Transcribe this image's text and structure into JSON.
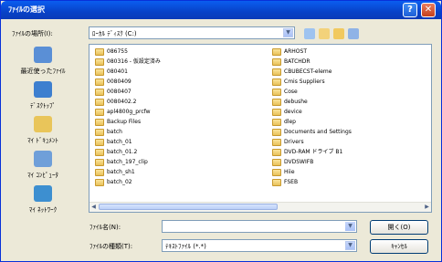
{
  "window": {
    "title": "ﾌｧｲﾙの選択",
    "help_glyph": "?",
    "close_glyph": "✕"
  },
  "lookin": {
    "label": "ﾌｧｲﾙの場所(I):",
    "value": "ﾛｰｶﾙ ﾃﾞｨｽｸ (C:)"
  },
  "places": [
    {
      "label": "最近使ったﾌｧｲﾙ",
      "icon": "recent-icon",
      "color": "#5a8fd6"
    },
    {
      "label": "ﾃﾞｽｸﾄｯﾌﾟ",
      "icon": "desktop-icon",
      "color": "#3d7fcf"
    },
    {
      "label": "ﾏｲ ﾄﾞｷｭﾒﾝﾄ",
      "icon": "my-documents-icon",
      "color": "#e9c55a"
    },
    {
      "label": "ﾏｲ ｺﾝﾋﾟｭｰﾀ",
      "icon": "my-computer-icon",
      "color": "#6f9fd9"
    },
    {
      "label": "ﾏｲ ﾈｯﾄﾜｰｸ",
      "icon": "my-network-icon",
      "color": "#3d8fd0"
    }
  ],
  "files_left": [
    "086755",
    "080316 - 仮設定済み",
    "080401",
    "0080409",
    "0080407",
    "0080402.2",
    "apl4800g_prcfw",
    "Backup Files",
    "batch",
    "batch_01",
    "batch_01.2",
    "batch_197_clip",
    "batch_sh1",
    "batch_02"
  ],
  "files_right": [
    "ARHOST",
    "BATCHDR",
    "CBUBECST-eleme",
    "Cmis Suppliers",
    "Cose",
    "debushe",
    "device",
    "dlep",
    "Documents and Settings",
    "Drivers",
    "DVD-RAM ドライブ B1",
    "DVDSWIFB",
    "Hiie",
    "FSEB"
  ],
  "filename": {
    "label": "ﾌｧｲﾙ名(N):",
    "value": ""
  },
  "filetype": {
    "label": "ﾌｧｲﾙの種類(T):",
    "value": "ﾃｷｽﾄﾌｧｲﾙ (*.*)"
  },
  "buttons": {
    "open": "開く(O)",
    "cancel": "ｷｬﾝｾﾙ"
  }
}
